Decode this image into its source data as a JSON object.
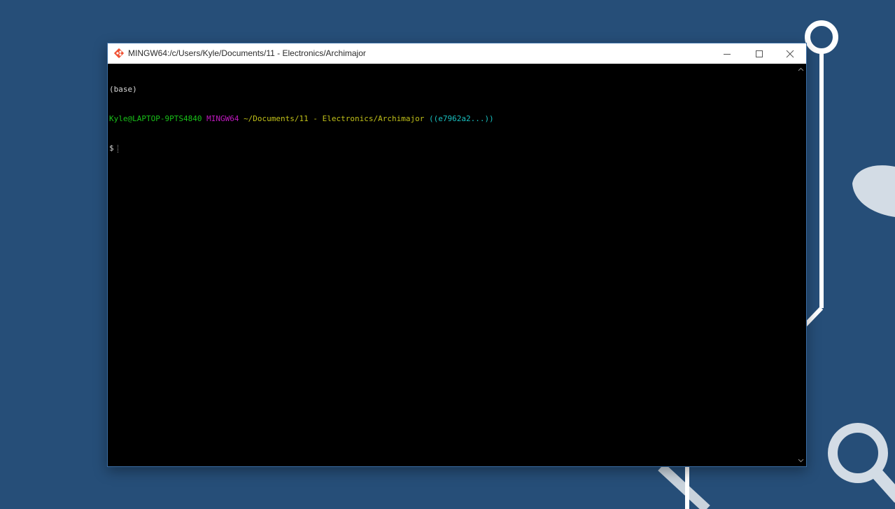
{
  "window": {
    "title": "MINGW64:/c/Users/Kyle/Documents/11 - Electronics/Archimajor",
    "app_icon": "git-bash-icon",
    "controls": {
      "minimize_icon": "minimize-icon",
      "maximize_icon": "maximize-icon",
      "close_icon": "close-icon"
    }
  },
  "terminal": {
    "lines": {
      "env": "(base)",
      "prompt": {
        "user_host": "Kyle@LAPTOP-9PTS4840",
        "system": "MINGW64",
        "path": "~/Documents/11 - Electronics/Archimajor",
        "branch": "((e7962a2...))"
      },
      "input_prefix": "$"
    },
    "colors": {
      "background": "#000000",
      "text": "#d8d8d8",
      "user_host": "#19c119",
      "system": "#c019c0",
      "path": "#c0c019",
      "branch": "#19c0c0"
    }
  },
  "desktop": {
    "background": "#264e78",
    "wallpaper_icons": [
      "circuit-node-icon",
      "leaf-icon",
      "search-magnifier-icon"
    ]
  }
}
